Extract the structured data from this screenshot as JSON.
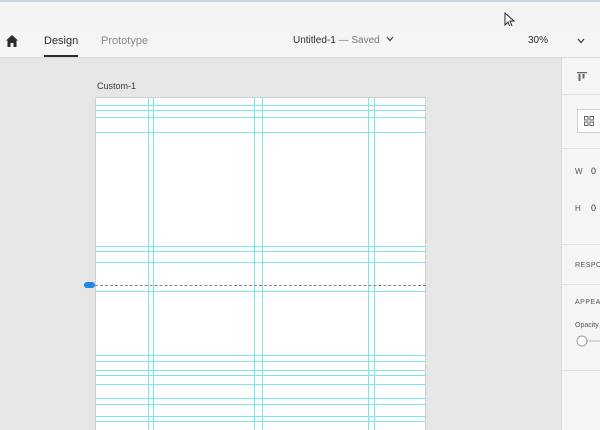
{
  "toolbar": {
    "tabs": [
      {
        "label": "Design",
        "active": true
      },
      {
        "label": "Prototype",
        "active": false
      }
    ],
    "document": {
      "name": "Untitled-1",
      "separator": "—",
      "status": "Saved"
    },
    "zoom": "30%"
  },
  "canvas": {
    "artboard_label": "Custom-1"
  },
  "properties": {
    "width_label": "W",
    "width_value": "0",
    "height_label": "H",
    "height_value": "0",
    "responsive_heading": "RESPO",
    "appearance_heading": "APPEA",
    "opacity_label": "Opacity"
  },
  "colors": {
    "grid_line": "#7fe6ef",
    "guide_handle": "#1e88e5",
    "panel_bg": "#f5f5f5",
    "canvas_bg": "#e6e6e6"
  },
  "icons": [
    "home-icon",
    "cursor-icon",
    "chevron-down-icon",
    "align-icon",
    "grid-icon"
  ]
}
